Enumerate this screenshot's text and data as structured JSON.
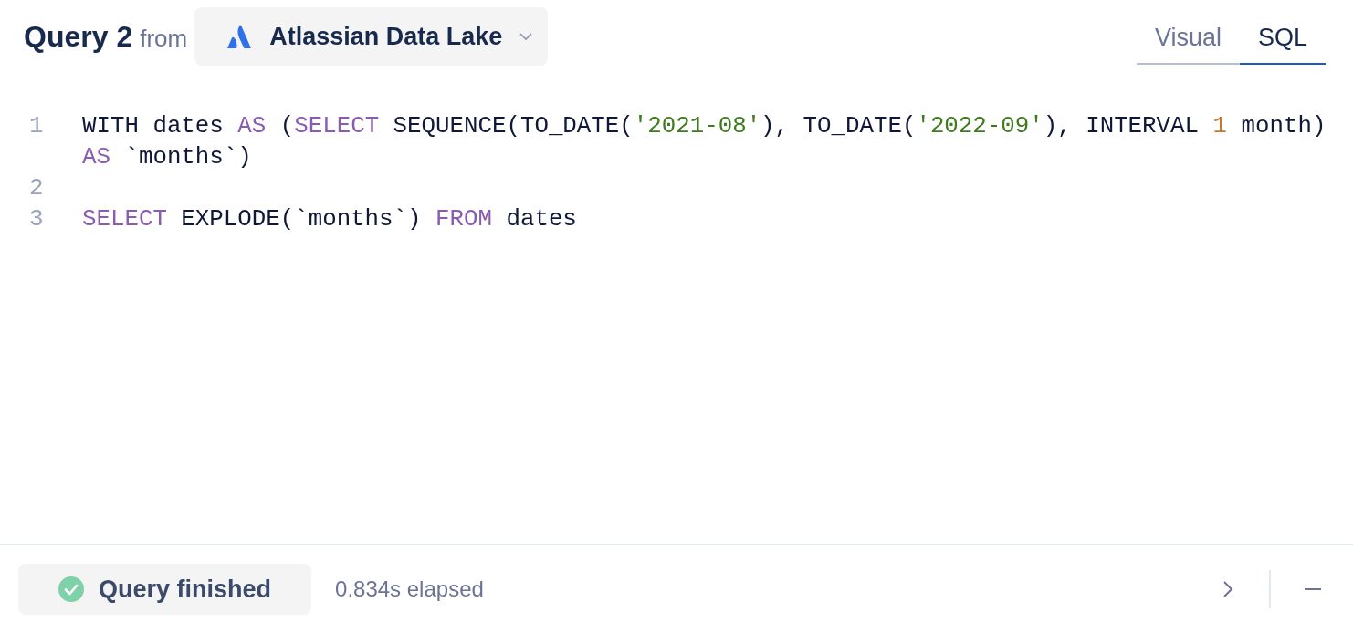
{
  "header": {
    "title": "Query 2",
    "from_label": "from",
    "source": {
      "label": "Atlassian Data Lake"
    }
  },
  "tabs": [
    {
      "label": "Visual",
      "selected": false
    },
    {
      "label": "SQL",
      "selected": true
    }
  ],
  "editor": {
    "lines": [
      {
        "number": "1",
        "tokens": [
          {
            "kind": "plain",
            "text": "WITH dates "
          },
          {
            "kind": "keyword",
            "text": "AS"
          },
          {
            "kind": "plain",
            "text": " ("
          },
          {
            "kind": "keyword",
            "text": "SELECT"
          },
          {
            "kind": "plain",
            "text": " SEQUENCE(TO_DATE("
          },
          {
            "kind": "string",
            "text": "'2021-08'"
          },
          {
            "kind": "plain",
            "text": "), TO_DATE("
          },
          {
            "kind": "string",
            "text": "'2022-09'"
          },
          {
            "kind": "plain",
            "text": "), INTERVAL "
          },
          {
            "kind": "number",
            "text": "1"
          },
          {
            "kind": "plain",
            "text": " month)"
          },
          {
            "kind": "break"
          },
          {
            "kind": "keyword",
            "text": "AS"
          },
          {
            "kind": "plain",
            "text": " `months`)"
          }
        ]
      },
      {
        "number": "2"
      },
      {
        "number": "3",
        "tokens": [
          {
            "kind": "keyword",
            "text": "SELECT"
          },
          {
            "kind": "plain",
            "text": " EXPLODE(`months`) "
          },
          {
            "kind": "keyword",
            "text": "FROM"
          },
          {
            "kind": "plain",
            "text": " dates"
          }
        ]
      }
    ]
  },
  "status_bar": {
    "status": {
      "label": "Query finished",
      "success": true
    },
    "elapsed": "0.834s elapsed"
  }
}
